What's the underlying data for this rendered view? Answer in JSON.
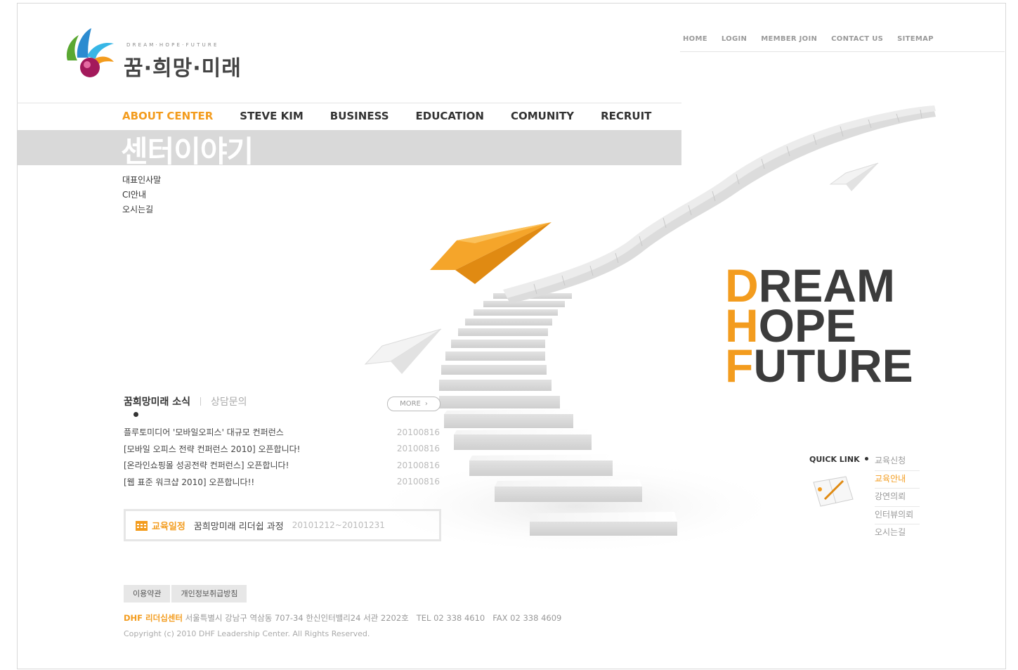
{
  "logo": {
    "tagline": "DREAM·HOPE·FUTURE",
    "name": "꿈·희망·미래"
  },
  "util_nav": [
    "HOME",
    "LOGIN",
    "MEMBER JOIN",
    "CONTACT US",
    "SITEMAP"
  ],
  "main_nav": [
    {
      "label": "ABOUT CENTER",
      "active": true
    },
    {
      "label": "STEVE KIM",
      "active": false
    },
    {
      "label": "BUSINESS",
      "active": false
    },
    {
      "label": "EDUCATION",
      "active": false
    },
    {
      "label": "COMUNITY",
      "active": false
    },
    {
      "label": "RECRUIT",
      "active": false
    }
  ],
  "section": {
    "title": "센터이야기",
    "submenu": [
      "대표인사말",
      "CI안내",
      "오시는길"
    ]
  },
  "hero": {
    "lines": [
      {
        "initial": "D",
        "rest": "REAM"
      },
      {
        "initial": "H",
        "rest": "OPE"
      },
      {
        "initial": "F",
        "rest": "UTURE"
      }
    ]
  },
  "news": {
    "tab_active": "꿈희망미래 소식",
    "tab_inactive": "상담문의",
    "more_label": "MORE",
    "items": [
      {
        "title": "플루토미디어 '모바일오피스' 대규모 컨퍼런스",
        "date": "20100816"
      },
      {
        "title": "[모바일 오피스 전략 컨퍼런스 2010] 오픈합니다!",
        "date": "20100816"
      },
      {
        "title": "[온라인쇼핑몰 성공전략 컨퍼런스] 오픈합니다!",
        "date": "20100816"
      },
      {
        "title": "[웹 표준 워크샵 2010] 오픈합니다!!",
        "date": "20100816"
      }
    ]
  },
  "schedule": {
    "label": "교육일정",
    "course": "꿈희망미래 리더쉽 과정",
    "dates": "20101212~20101231"
  },
  "quick_link": {
    "title": "QUICK LINK",
    "items": [
      {
        "label": "교육신청",
        "active": false
      },
      {
        "label": "교육안내",
        "active": true
      },
      {
        "label": "강연의뢰",
        "active": false
      },
      {
        "label": "인터뷰의뢰",
        "active": false
      },
      {
        "label": "오시는길",
        "active": false
      }
    ]
  },
  "footer": {
    "buttons": [
      "이용약관",
      "개인정보취급방침"
    ],
    "brand": "DHF 리더십센터",
    "address": "서울특별시 강남구 역삼동 707-34 한신인터밸리24 서관 2202호",
    "tel": "TEL 02 338 4610",
    "fax": "FAX 02 338 4609",
    "copyright": "Copyright (c) 2010 DHF Leadership Center. All Rights Reserved."
  },
  "colors": {
    "accent": "#f39c1e",
    "text": "#333333",
    "muted": "#999999",
    "band": "#d9d9d9"
  }
}
